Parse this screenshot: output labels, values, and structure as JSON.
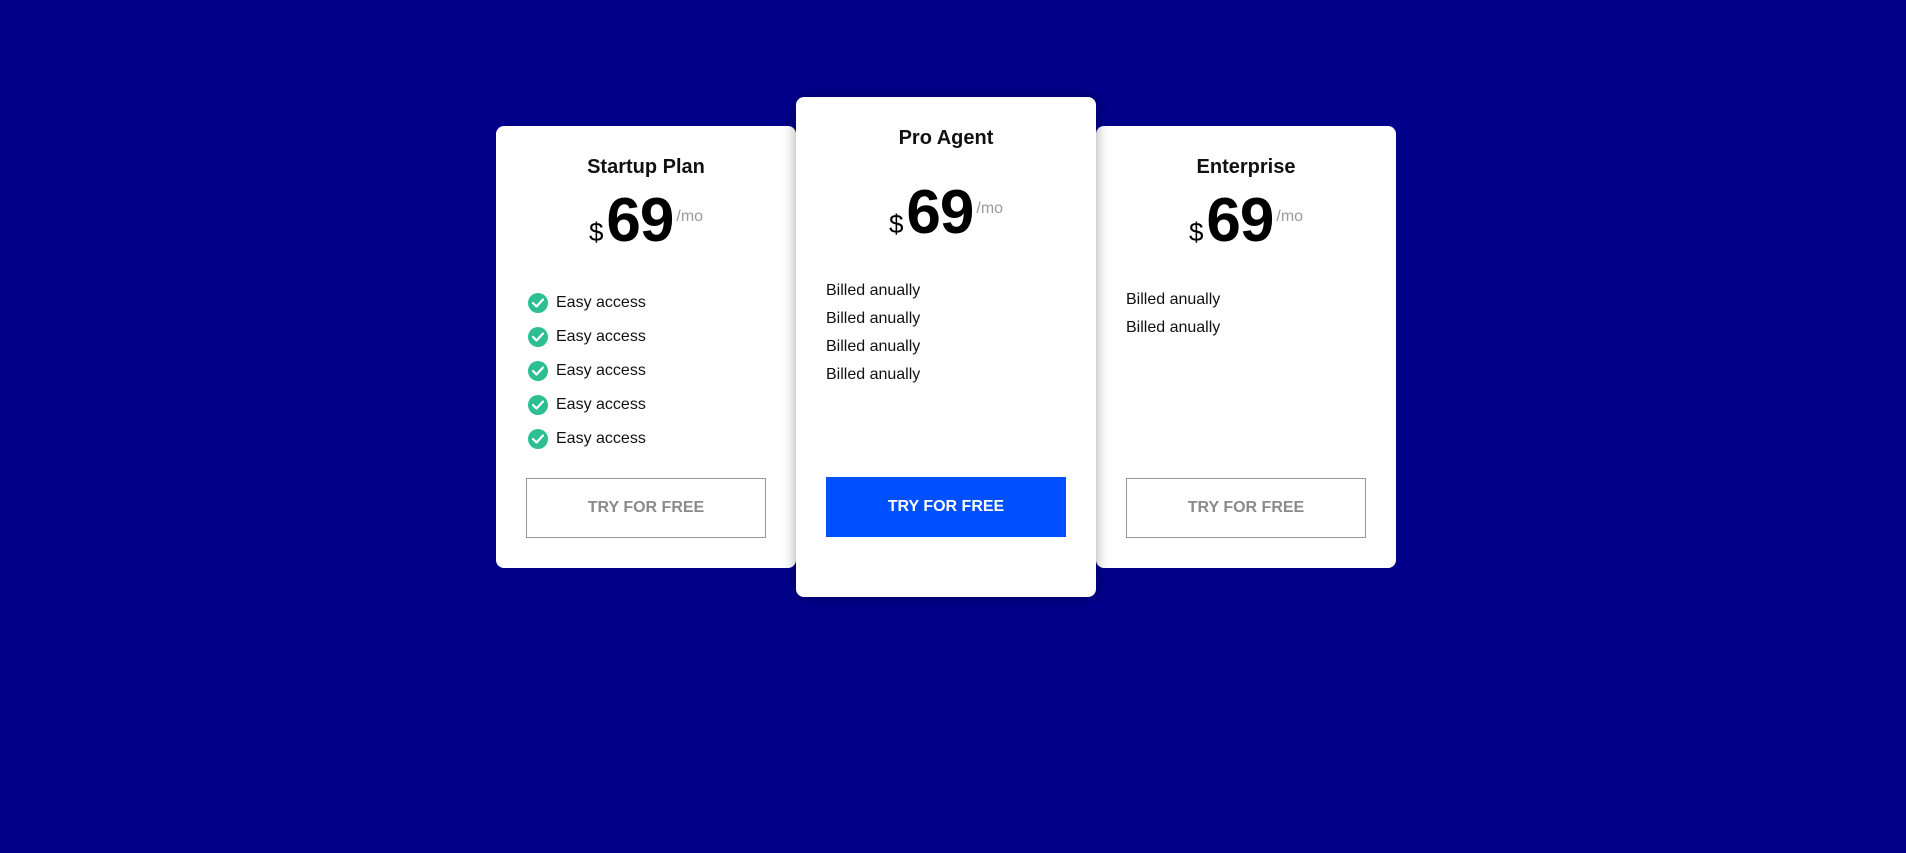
{
  "colors": {
    "background": "#00008b",
    "card": "#ffffff",
    "primary_button": "#0050ff",
    "check": "#2ebf91"
  },
  "plans": [
    {
      "title": "Startup Plan",
      "currency": "$",
      "price": "69",
      "period": "/mo",
      "features": [
        "Easy access",
        "Easy access",
        "Easy access",
        "Easy access",
        "Easy access"
      ],
      "feature_icon": "check-circle-icon",
      "cta": "TRY FOR FREE"
    },
    {
      "title": "Pro Agent",
      "currency": "$",
      "price": "69",
      "period": "/mo",
      "features": [
        "Billed anually",
        "Billed anually",
        "Billed anually",
        "Billed anually"
      ],
      "cta": "TRY FOR FREE"
    },
    {
      "title": "Enterprise",
      "currency": "$",
      "price": "69",
      "period": "/mo",
      "features": [
        "Billed anually",
        "Billed anually"
      ],
      "cta": "TRY FOR FREE"
    }
  ]
}
